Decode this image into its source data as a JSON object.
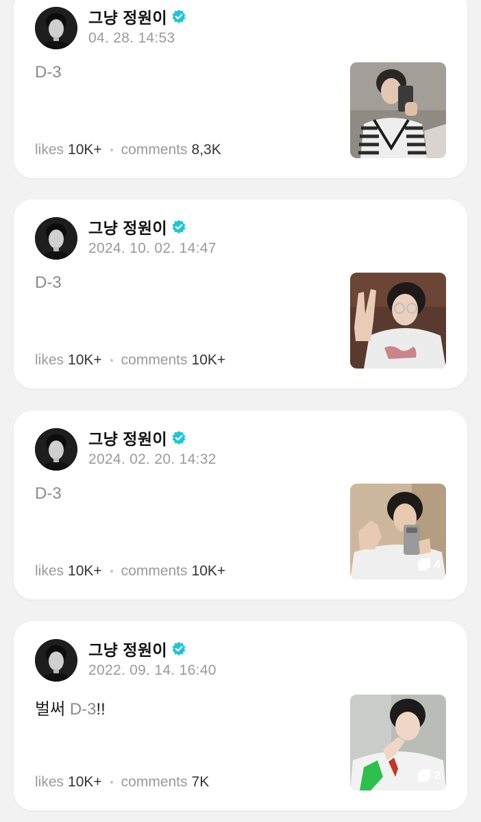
{
  "feed": {
    "posts": [
      {
        "author": "그냥 정원이",
        "time": "04. 28. 14:53",
        "text": "D-3",
        "text_prefix": "",
        "text_highlight": "D-3",
        "text_suffix": "",
        "likes_label": "likes",
        "likes": "10K+",
        "comments_label": "comments",
        "comments": "8,3K",
        "photo_count": ""
      },
      {
        "author": "그냥 정원이",
        "time": "2024. 10. 02. 14:47",
        "text_prefix": "",
        "text_highlight": "D-3",
        "text_suffix": "",
        "likes_label": "likes",
        "likes": "10K+",
        "comments_label": "comments",
        "comments": "10K+",
        "photo_count": ""
      },
      {
        "author": "그냥 정원이",
        "time": "2024. 02. 20. 14:32",
        "text_prefix": "",
        "text_highlight": "D-3",
        "text_suffix": "",
        "likes_label": "likes",
        "likes": "10K+",
        "comments_label": "comments",
        "comments": "10K+",
        "photo_count": "4"
      },
      {
        "author": "그냥 정원이",
        "time": "2022. 09. 14. 16:40",
        "text_prefix": "벌써 ",
        "text_highlight": "D-3",
        "text_suffix": "!!",
        "likes_label": "likes",
        "likes": "10K+",
        "comments_label": "comments",
        "comments": "7K",
        "photo_count": "2"
      }
    ]
  },
  "colors": {
    "verified": "#22c4d4",
    "background": "#f2f2f3",
    "card": "#ffffff"
  },
  "icons": {
    "verified": "verified-badge-icon",
    "multi_photo": "multi-photo-icon"
  }
}
